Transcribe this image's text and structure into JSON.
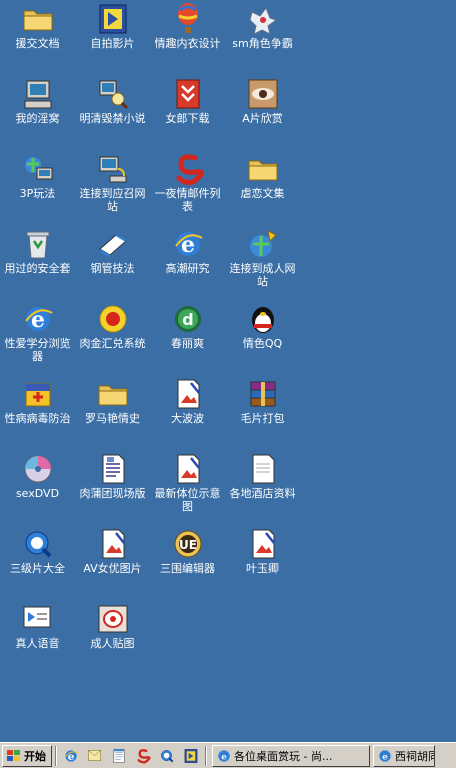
{
  "desktop": {
    "icons": [
      {
        "label": "援交文档",
        "icon": "folder-icon"
      },
      {
        "label": "自拍影片",
        "icon": "media-player-icon"
      },
      {
        "label": "情趣内衣设计",
        "icon": "balloon-icon"
      },
      {
        "label": "sm角色争霸",
        "icon": "game-icon"
      },
      {
        "label": "我的淫窝",
        "icon": "my-computer-icon"
      },
      {
        "label": "明清毁禁小说",
        "icon": "network-search-icon"
      },
      {
        "label": "女郎下载",
        "icon": "download-icon"
      },
      {
        "label": "A片欣赏",
        "icon": "eye-image-icon"
      },
      {
        "label": "3P玩法",
        "icon": "network-places-icon"
      },
      {
        "label": "连接到应召网站",
        "icon": "dialup-icon"
      },
      {
        "label": "一夜情邮件列表",
        "icon": "mail-s-icon"
      },
      {
        "label": "虐恋文集",
        "icon": "folder-icon"
      },
      {
        "label": "用过的安全套",
        "icon": "recycle-bin-icon"
      },
      {
        "label": "钢管技法",
        "icon": "book-icon"
      },
      {
        "label": "高潮研究",
        "icon": "ie-icon"
      },
      {
        "label": "连接到成人网站",
        "icon": "connect-web-icon"
      },
      {
        "label": "性爱学分浏览器",
        "icon": "ie-icon"
      },
      {
        "label": "肉金汇兑系统",
        "icon": "flower-icon"
      },
      {
        "label": "春丽爽",
        "icon": "dreamweaver-icon"
      },
      {
        "label": "情色QQ",
        "icon": "qq-penguin-icon"
      },
      {
        "label": "性病病毒防治",
        "icon": "antivirus-icon"
      },
      {
        "label": "罗马艳情史",
        "icon": "folder-icon"
      },
      {
        "label": "大波波",
        "icon": "image-doc-icon"
      },
      {
        "label": "毛片打包",
        "icon": "winrar-icon"
      },
      {
        "label": "sexDVD",
        "icon": "dvd-icon"
      },
      {
        "label": "肉蒲团现场版",
        "icon": "document-icon"
      },
      {
        "label": "最新体位示意图",
        "icon": "image-doc-icon"
      },
      {
        "label": "各地酒店资料",
        "icon": "text-file-icon"
      },
      {
        "label": "三级片大全",
        "icon": "quicktime-icon"
      },
      {
        "label": "AV女优图片",
        "icon": "image-doc-icon"
      },
      {
        "label": "三围编辑器",
        "icon": "ultraedit-icon"
      },
      {
        "label": "叶玉卿",
        "icon": "image-doc-icon"
      },
      {
        "label": "真人语音",
        "icon": "speech-icon"
      },
      {
        "label": "成人贴图",
        "icon": "photo-editor-icon"
      }
    ]
  },
  "taskbar": {
    "start_label": "开始",
    "quick_launch": [
      "ie-icon",
      "outlook-icon",
      "notepad-icon",
      "mail-s-icon",
      "quicktime-icon",
      "media-player-icon"
    ],
    "tasks": [
      {
        "label": "各位桌面赏玩 - 尚..."
      },
      {
        "label": "西祠胡同 -"
      }
    ]
  }
}
